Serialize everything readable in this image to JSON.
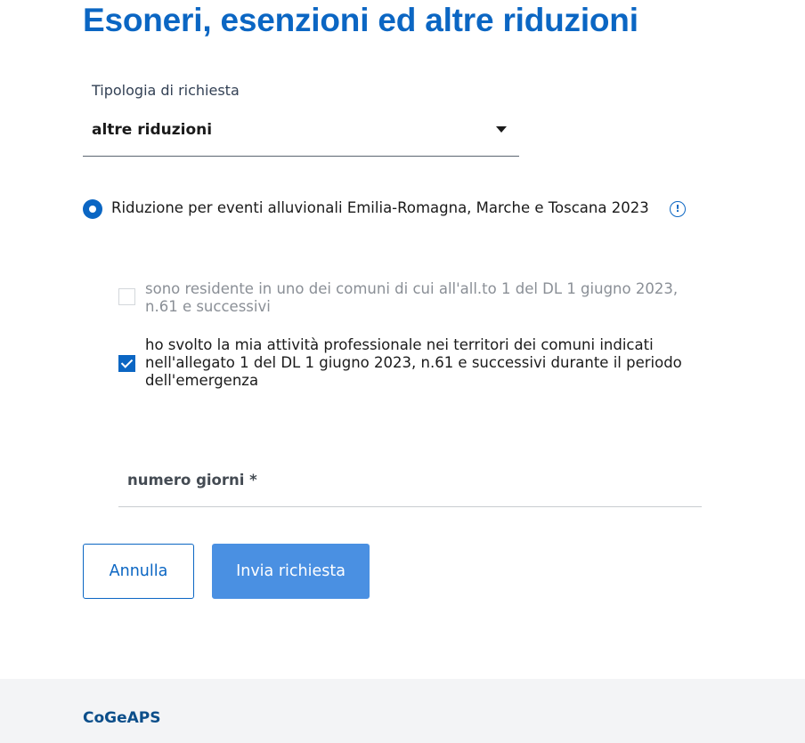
{
  "page": {
    "title": "Esoneri, esenzioni ed altre riduzioni"
  },
  "request_type": {
    "label": "Tipologia di richiesta",
    "selected_value": "altre riduzioni"
  },
  "option": {
    "label": "Riduzione per eventi alluvionali Emilia-Romagna, Marche e Toscana 2023",
    "selected": true,
    "info_icon": "info-icon"
  },
  "checkboxes": [
    {
      "text": "sono residente in uno dei comuni di cui all'all.to 1 del DL 1 giugno 2023, n.61 e successivi",
      "checked": false,
      "disabled": true
    },
    {
      "text": "ho svolto la mia attività professionale nei territori dei comuni indicati nell'allegato 1 del DL 1 giugno 2023, n.61 e successivi durante il periodo dell'emergenza",
      "checked": true,
      "disabled": false
    }
  ],
  "days_field": {
    "label": "numero giorni *",
    "value": ""
  },
  "buttons": {
    "cancel": "Annulla",
    "submit": "Invia richiesta"
  },
  "footer": {
    "brand": "CoGeAPS"
  },
  "colors": {
    "primary": "#0b66c3",
    "submit_bg": "#4a90e2",
    "footer_bg": "#f3f4f6"
  }
}
